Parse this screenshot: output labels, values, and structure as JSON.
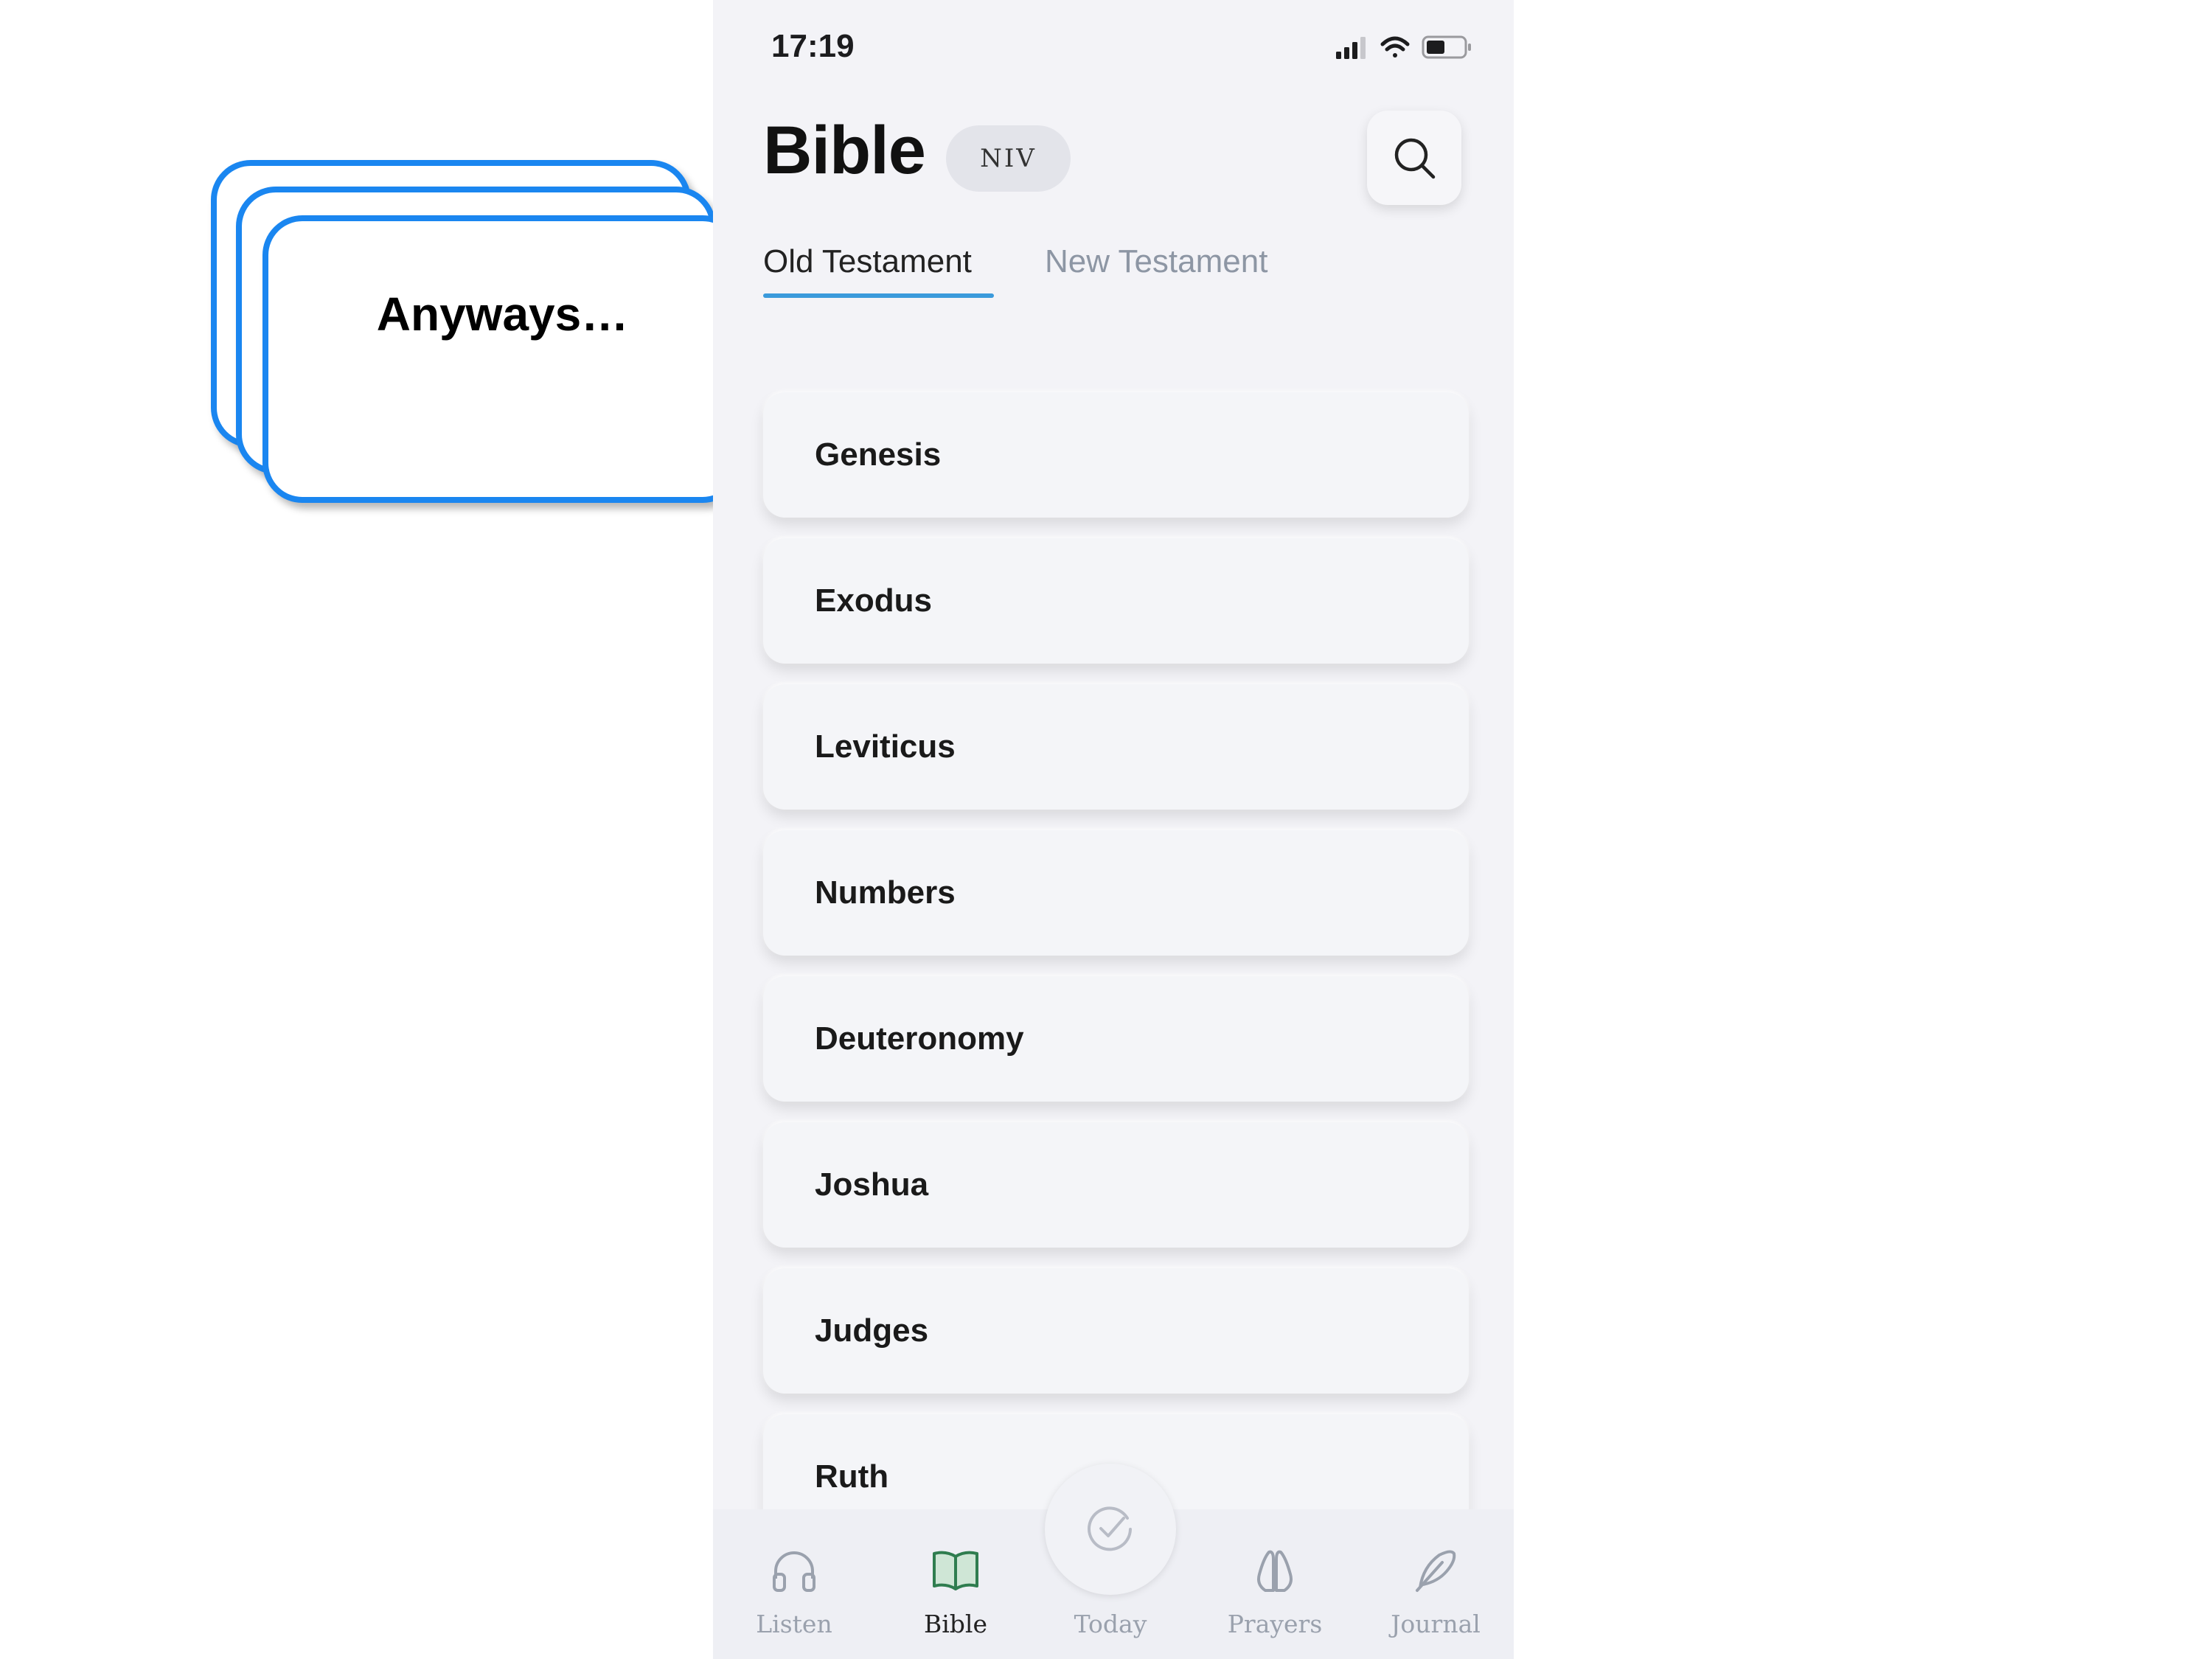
{
  "slide": {
    "card_text": "Anyways…"
  },
  "status_bar": {
    "time": "17:19"
  },
  "header": {
    "title": "Bible",
    "version": "NIV"
  },
  "tabs": [
    {
      "label": "Old Testament",
      "selected": true
    },
    {
      "label": "New Testament",
      "selected": false
    }
  ],
  "books": [
    "Genesis",
    "Exodus",
    "Leviticus",
    "Numbers",
    "Deuteronomy",
    "Joshua",
    "Judges",
    "Ruth"
  ],
  "nav": [
    {
      "label": "Listen",
      "icon": "headphones-icon"
    },
    {
      "label": "Bible",
      "icon": "open-book-icon",
      "active": true
    },
    {
      "label": "Today",
      "icon": "check-circle-icon"
    },
    {
      "label": "Prayers",
      "icon": "praying-hands-icon"
    },
    {
      "label": "Journal",
      "icon": "feather-icon"
    }
  ],
  "colors": {
    "accent": "#3a9adb",
    "card_border": "#1a86f0",
    "active_icon": "#2f7d4f"
  }
}
